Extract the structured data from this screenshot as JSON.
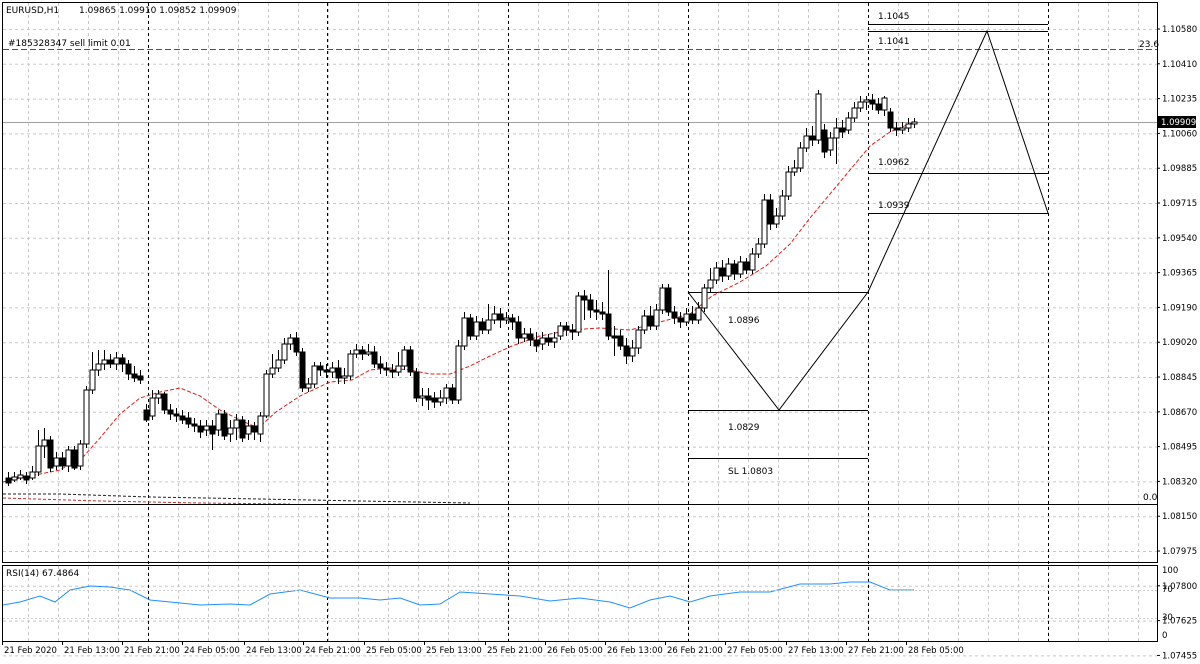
{
  "header": {
    "symbol": "EURUSD,H1",
    "ohlc": "1.09865 1.09910 1.09852 1.09909"
  },
  "order_label": "#185328347 sell limit 0.01",
  "fib_labels": {
    "top": "23.6",
    "bottom": "0.0"
  },
  "levels": {
    "l1045": "1.1045",
    "l1041": "1.1041",
    "l0962": "1.0962",
    "l0939": "1.0939",
    "l0896": "1.0896",
    "l0829": "1.0829",
    "sl": "SL 1.0803"
  },
  "current_price": "1.09909",
  "price_axis": [
    "1.10580",
    "1.10410",
    "1.10235",
    "1.10060",
    "1.09885",
    "1.09715",
    "1.09540",
    "1.09365",
    "1.09190",
    "1.09020",
    "1.08845",
    "1.08670",
    "1.08495",
    "1.08320",
    "1.08150",
    "1.07975",
    "1.07800",
    "1.07625",
    "1.07455"
  ],
  "rsi": {
    "label": "RSI(14) 67.4864",
    "axis": [
      "100",
      "70",
      "30",
      "0"
    ]
  },
  "time_axis": [
    "21 Feb 2020",
    "21 Feb 13:00",
    "21 Feb 21:00",
    "24 Feb 05:00",
    "24 Feb 13:00",
    "24 Feb 21:00",
    "25 Feb 05:00",
    "25 Feb 13:00",
    "25 Feb 21:00",
    "26 Feb 05:00",
    "26 Feb 13:00",
    "26 Feb 21:00",
    "27 Feb 05:00",
    "27 Feb 13:00",
    "27 Feb 21:00",
    "28 Feb 05:00"
  ],
  "colors": {
    "candle_up": "#ffffff",
    "candle_down": "#000000",
    "ma": "#e0201c",
    "rsi": "#1e90ff",
    "order_line": "#1a7a1a",
    "grid": "#c8c8c8"
  }
}
